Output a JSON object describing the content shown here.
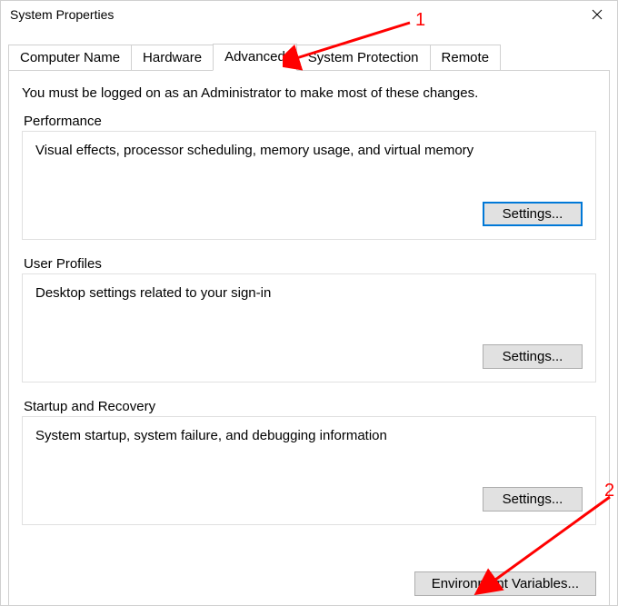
{
  "window": {
    "title": "System Properties"
  },
  "tabs": {
    "items": [
      {
        "label": "Computer Name"
      },
      {
        "label": "Hardware"
      },
      {
        "label": "Advanced"
      },
      {
        "label": "System Protection"
      },
      {
        "label": "Remote"
      }
    ],
    "active_index": 2
  },
  "advanced": {
    "intro": "You must be logged on as an Administrator to make most of these changes.",
    "performance": {
      "title": "Performance",
      "desc": "Visual effects, processor scheduling, memory usage, and virtual memory",
      "button": "Settings..."
    },
    "user_profiles": {
      "title": "User Profiles",
      "desc": "Desktop settings related to your sign-in",
      "button": "Settings..."
    },
    "startup": {
      "title": "Startup and Recovery",
      "desc": "System startup, system failure, and debugging information",
      "button": "Settings..."
    },
    "env_button": "Environment Variables..."
  },
  "annotations": {
    "one": "1",
    "two": "2"
  }
}
